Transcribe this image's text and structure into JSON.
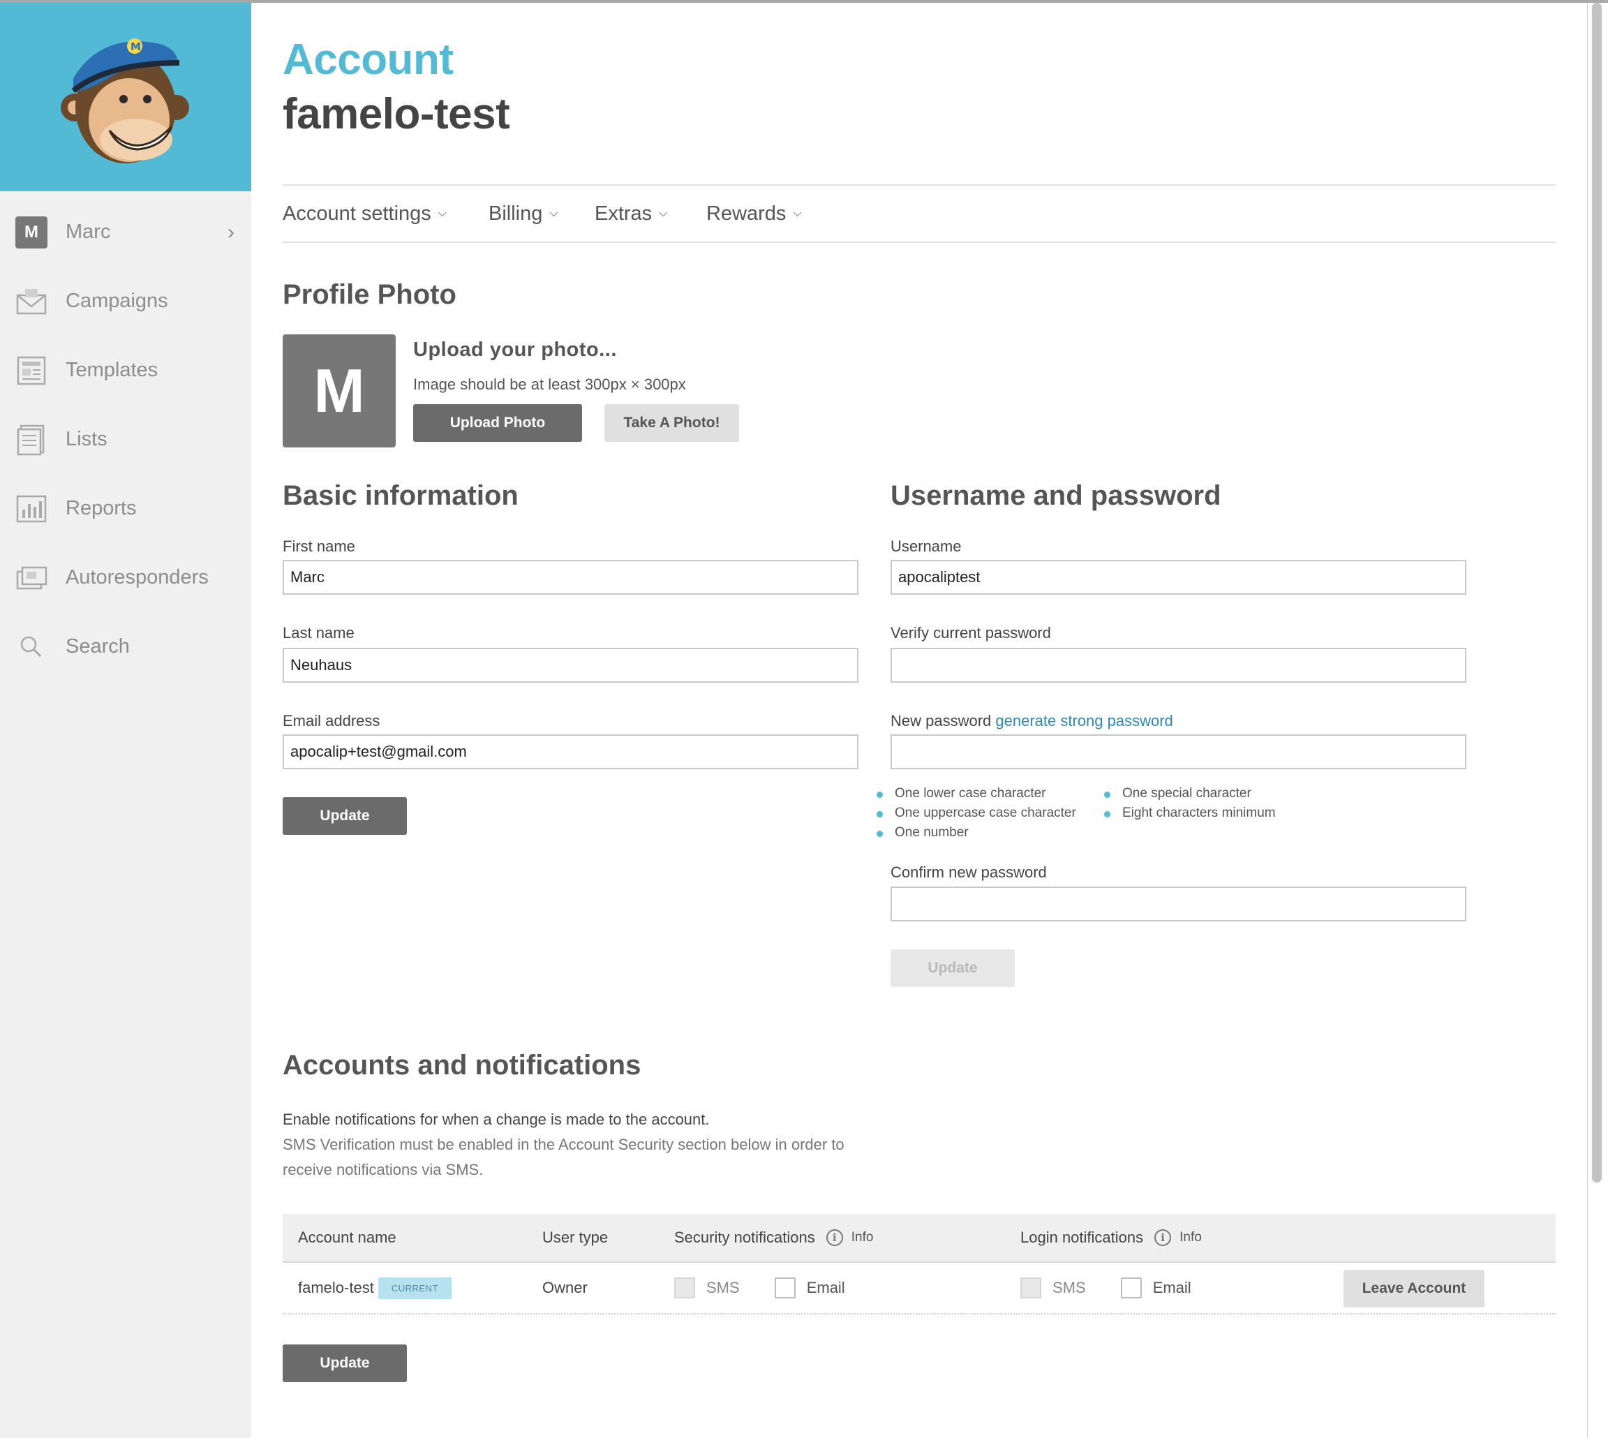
{
  "sidebar": {
    "user": {
      "initial": "M",
      "name": "Marc"
    },
    "items": [
      {
        "label": "Campaigns",
        "icon": "campaigns-icon"
      },
      {
        "label": "Templates",
        "icon": "templates-icon"
      },
      {
        "label": "Lists",
        "icon": "lists-icon"
      },
      {
        "label": "Reports",
        "icon": "reports-icon"
      },
      {
        "label": "Autoresponders",
        "icon": "autoresponders-icon"
      },
      {
        "label": "Search",
        "icon": "search-icon"
      }
    ],
    "logo_color": "#52bad5"
  },
  "header": {
    "title": "Account",
    "org_name": "famelo-test"
  },
  "tabs": [
    {
      "label": "Account settings"
    },
    {
      "label": "Billing"
    },
    {
      "label": "Extras"
    },
    {
      "label": "Rewards"
    }
  ],
  "profile_photo": {
    "heading": "Profile Photo",
    "initial": "M",
    "upload_title": "Upload your photo...",
    "hint": "Image should be at least 300px × 300px",
    "upload_button": "Upload Photo",
    "take_photo_button": "Take A Photo!"
  },
  "basic_info": {
    "heading": "Basic information",
    "first_name_label": "First name",
    "first_name_value": "Marc",
    "last_name_label": "Last name",
    "last_name_value": "Neuhaus",
    "email_label": "Email address",
    "email_value": "apocalip+test@gmail.com",
    "update_button": "Update"
  },
  "credentials": {
    "heading": "Username and password",
    "username_label": "Username",
    "username_value": "apocaliptest",
    "verify_label": "Verify current password",
    "verify_value": "",
    "new_password_label": "New password",
    "generate_link": "generate strong password",
    "new_password_value": "",
    "rules": [
      "One lower case character",
      "One uppercase case character",
      "One number",
      "One special character",
      "Eight characters minimum"
    ],
    "confirm_label": "Confirm new password",
    "confirm_value": "",
    "update_button": "Update"
  },
  "notifications": {
    "heading": "Accounts and notifications",
    "desc_line1": "Enable notifications for when a change is made to the account.",
    "desc_line2": "SMS Verification must be enabled in the Account Security section below in order to receive notifications via SMS.",
    "columns": {
      "account_name": "Account name",
      "user_type": "User type",
      "security": "Security notifications",
      "login": "Login notifications",
      "info": "Info"
    },
    "rows": [
      {
        "account_name": "famelo-test",
        "badge": "CURRENT",
        "user_type": "Owner",
        "sms_label": "SMS",
        "email_label": "Email",
        "leave_button": "Leave Account"
      }
    ],
    "update_button": "Update"
  },
  "colors": {
    "accent": "#52bad5",
    "link": "#2d8ab8",
    "dark_button": "#6b6b6b"
  }
}
